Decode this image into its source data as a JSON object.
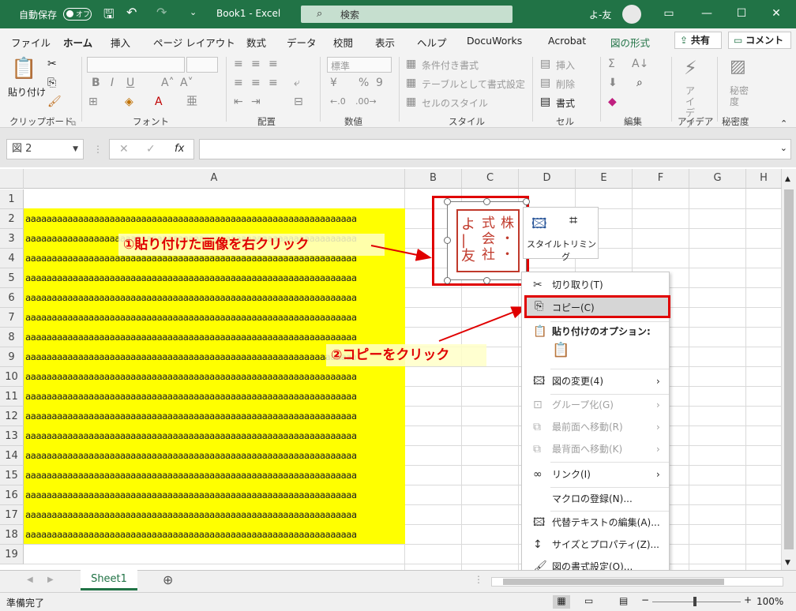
{
  "titlebar": {
    "autosave_label": "自動保存",
    "autosave_state": "オフ",
    "doc_title": "Book1  -  Excel",
    "search_placeholder": "検索",
    "user_name": "よ-友"
  },
  "tabs": [
    "ファイル",
    "ホーム",
    "挿入",
    "ページ レイアウト",
    "数式",
    "データ",
    "校閲",
    "表示",
    "ヘルプ",
    "DocuWorks",
    "Acrobat",
    "図の形式"
  ],
  "share_label": "共有",
  "comment_label": "コメント",
  "ribbon": {
    "paste_label": "貼り付け",
    "number_format": "標準",
    "cond_format": "条件付き書式",
    "table_format": "テーブルとして書式設定",
    "cell_style": "セルのスタイル",
    "insert": "挿入",
    "delete": "削除",
    "format": "書式",
    "ideas": "アイ デア",
    "sensitivity": "秘密 度",
    "groups": [
      "クリップボード",
      "フォント",
      "配置",
      "数値",
      "スタイル",
      "セル",
      "編集",
      "アイデア",
      "秘密度"
    ]
  },
  "namebox": "図 2",
  "fx_label": "fx",
  "columns": [
    "A",
    "B",
    "C",
    "D",
    "E",
    "F",
    "G",
    "H"
  ],
  "rows": [
    "1",
    "2",
    "3",
    "4",
    "5",
    "6",
    "7",
    "8",
    "9",
    "10",
    "11",
    "12",
    "13",
    "14",
    "15",
    "16",
    "17",
    "18",
    "19"
  ],
  "cell_text": "aaaaaaaaaaaaaaaaaaaaaaaaaaaaaaaaaaaaaaaaaaaaaaaaaaaaaaaaaaaaaaa",
  "callout1": "①貼り付けた画像を右クリック",
  "callout2": "②コピーをクリック",
  "mini_toolbar": {
    "style": "スタイル",
    "trim": "トリミング"
  },
  "context_menu": {
    "cut": "切り取り(T)",
    "copy": "コピー(C)",
    "paste_options": "貼り付けのオプション:",
    "change_picture": "図の変更(4)",
    "group": "グループ化(G)",
    "bring_front": "最前面へ移動(R)",
    "send_back": "最背面へ移動(K)",
    "link": "リンク(I)",
    "assign_macro": "マクロの登録(N)...",
    "alt_text": "代替テキストの編集(A)...",
    "size_props": "サイズとプロパティ(Z)...",
    "format_picture": "図の書式設定(O)..."
  },
  "sheet_tab": "Sheet1",
  "status_text": "準備完了",
  "zoom": "100%",
  "colors": {
    "excel_green": "#217346",
    "highlight_red": "#e00000",
    "cell_fill": "#ffff00"
  }
}
